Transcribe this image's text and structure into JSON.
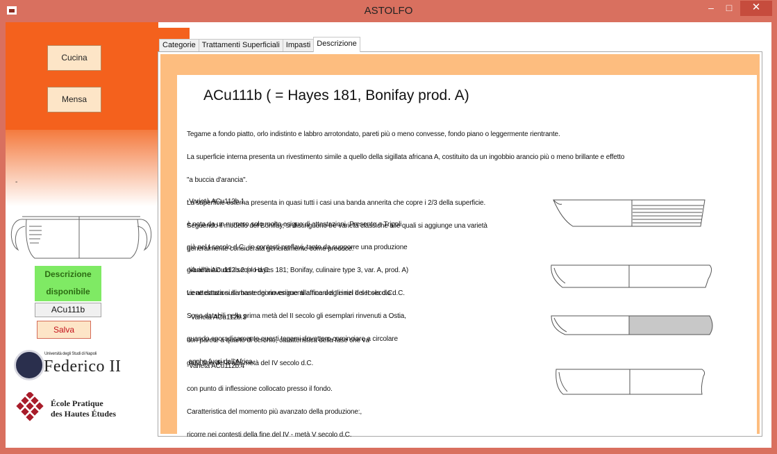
{
  "window": {
    "title": "ASTOLFO",
    "min_glyph": "–",
    "max_glyph": "□",
    "close_glyph": "✕"
  },
  "sidebar": {
    "cucina_label": "Cucina",
    "mensa_label": "Mensa",
    "dash": "-",
    "desc_line1": "Descrizione",
    "desc_line2": "disponibile",
    "code_value": "ACu111b",
    "save_label": "Salva",
    "uni_small": "Università degli Studi di Napoli",
    "uni_name": "Federico II",
    "ephe_line1": "École Pratique",
    "ephe_line2": "des Hautes Études"
  },
  "tabs": [
    {
      "label": "Categorie"
    },
    {
      "label": "Trattamenti Superficiali"
    },
    {
      "label": "Impasti"
    },
    {
      "label": "Descrizione"
    }
  ],
  "content": {
    "heading": "ACu111b ( = Hayes 181, Bonifay prod. A)",
    "intro": [
      "Tegame a fondo piatto, orlo indistinto e labbro arrotondato, pareti più o meno convesse, fondo piano o leggermente rientrante.",
      "La superficie interna presenta un rivestimento simile a quello della sigillata africana A, costituito da un ingobbio arancio più o meno brillante e effetto",
      "\"a buccia d'arancia\".",
      "La superficie esterna presenta in quasi tutti i casi una banda annerita che copre i 2/3 della superficie.",
      "Seguendo il modello del Bonifay, si distinguono tre varietà classiche alle quali si aggiunge una varietà",
      "generalmente considerata generalmente come precoce:"
    ],
    "v1": [
      "-Varietà ACu112b.1",
      "è nota da un numero solo molto esiguo di attestazioni. Presente a Tripoli",
      "già nel I secolo d.C., in contesti preflavi, tanto da supporre una produzione",
      "già all'inizio del I secolo d.C.",
      "Le attestazioni si mantengono esigue alla fine del I e nel II secolo d.C.",
      "Sono databili nella prima metà del II secolo gli esemplari rinvenuti a Ostia,",
      "quando sporadicamente questi tegami dovettero cominciare a circolare",
      " anche fuori dall'Africa."
    ],
    "v2": [
      "-Varietà ACu112b.2 (= Hayes 181; Bonifay, culinaire type 3, var. A, prod. A)",
      "viene datata sulla base dei rinvenimenti africani agli inizi del II secolo d.C."
    ],
    "v3": [
      " -Varietà ACu112b.3",
      "con parete a quarto di cerchio, caratteristica della fase che va",
      "dalla fine del II alla metà del IV secolo d.C."
    ],
    "v4": [
      "-Varietà ACu112b.4",
      "con punto di inflessione collocato presso il fondo.",
      "Caratteristica del momento più avanzato della produzione:,",
      "ricorre nei contesti della fine del IV - metà V secolo d.C."
    ]
  }
}
